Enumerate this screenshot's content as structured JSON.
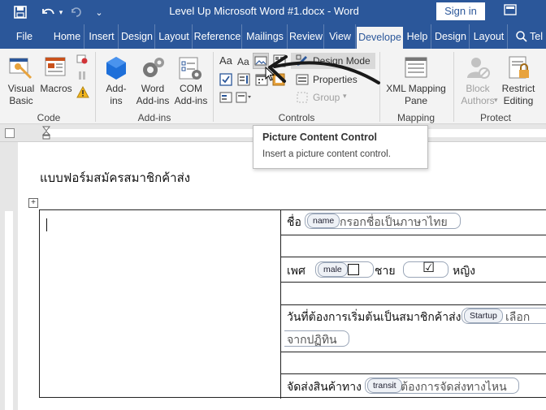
{
  "window": {
    "title": "Level Up Microsoft Word #1.docx - Word",
    "signin_label": "Sign in",
    "accent": "#2b579a"
  },
  "qat": {
    "save_icon": "save-icon",
    "undo_icon": "undo-icon",
    "redo_icon": "redo-icon",
    "customize_icon": "chevron-down-icon",
    "ribbon_display_icon": "ribbon-display-options-icon"
  },
  "tabs": [
    {
      "label": "File"
    },
    {
      "label": "Home"
    },
    {
      "label": "Insert"
    },
    {
      "label": "Design"
    },
    {
      "label": "Layout"
    },
    {
      "label": "Reference"
    },
    {
      "label": "Mailings"
    },
    {
      "label": "Review"
    },
    {
      "label": "View"
    },
    {
      "label": "Develope",
      "active": true
    },
    {
      "label": "Help"
    },
    {
      "label": "Design"
    },
    {
      "label": "Layout"
    },
    {
      "label": "Tel"
    }
  ],
  "ribbon": {
    "code": {
      "label": "Code",
      "visual_basic": "Visual Basic",
      "visual_basic_l1": "Visual",
      "visual_basic_l2": "Basic",
      "macros": "Macros"
    },
    "addins": {
      "label": "Add-ins",
      "addins_l1": "Add-",
      "addins_l2": "ins",
      "word_l1": "Word",
      "word_l2": "Add-ins",
      "com_l1": "COM",
      "com_l2": "Add-ins"
    },
    "controls": {
      "label": "Controls",
      "design_mode": "Design Mode",
      "properties": "Properties",
      "group": "Group",
      "rich_text_glyph": "Aa",
      "plain_text_glyph": "Aa"
    },
    "mapping": {
      "label": "Mapping",
      "xml_l1": "XML Mapping",
      "xml_l2": "Pane"
    },
    "protect": {
      "label": "Protect",
      "block_l1": "Block",
      "block_l2": "Authors",
      "restrict_l1": "Restrict",
      "restrict_l2": "Editing"
    }
  },
  "tooltip": {
    "title": "Picture Content Control",
    "description": "Insert a picture content control."
  },
  "document": {
    "heading": "แบบฟอร์มสมัครสมาชิกค้าส่ง",
    "rows": {
      "name_label": "ชื่อ",
      "name_tag": "name",
      "name_placeholder": "กรอกชื่อเป็นภาษาไทย",
      "gender_label": "เพศ",
      "male_tag": "male",
      "male_text": "ชาย",
      "female_text": "หญิง",
      "female_checked_glyph": "☑",
      "start_label": "วันที่ต้องการเริ่มต้นเป็นสมาชิกค้าส่ง",
      "start_tag": "Startup",
      "start_placeholder_1": "เลือก",
      "start_placeholder_2": "จากปฏิทิน",
      "transit_label": "จัดส่งสินค้าทาง",
      "transit_tag": "transit",
      "transit_placeholder": "ต้องการจัดส่งทางไหน"
    }
  }
}
